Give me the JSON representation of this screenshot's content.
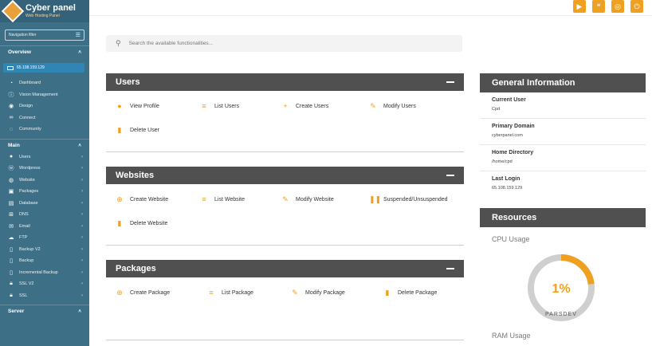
{
  "brand": {
    "title": "Cyber panel",
    "subtitle": "Web Hosting Panel"
  },
  "sidebar": {
    "filter_label": "Navigation filter",
    "overview_title": "Overview",
    "ip": "65.108.159.129",
    "overview_items": [
      {
        "label": "Dashboard",
        "icon": "gauge-icon"
      },
      {
        "label": "Vision Management",
        "icon": "info-icon"
      },
      {
        "label": "Design",
        "icon": "palette-icon"
      },
      {
        "label": "Connect",
        "icon": "link-icon"
      },
      {
        "label": "Community",
        "icon": "chat-icon"
      }
    ],
    "main_title": "Main",
    "main_items": [
      {
        "label": "Users",
        "icon": "users-icon"
      },
      {
        "label": "Wordpress",
        "icon": "wordpress-icon"
      },
      {
        "label": "Website",
        "icon": "globe-icon"
      },
      {
        "label": "Packages",
        "icon": "packages-icon"
      },
      {
        "label": "Database",
        "icon": "database-icon"
      },
      {
        "label": "DNS",
        "icon": "sitemap-icon"
      },
      {
        "label": "Email",
        "icon": "envelope-icon"
      },
      {
        "label": "FTP",
        "icon": "cloud-upload-icon"
      },
      {
        "label": "Backup V2",
        "icon": "file-icon"
      },
      {
        "label": "Backup",
        "icon": "file-icon"
      },
      {
        "label": "Incremental Backup",
        "icon": "file-icon"
      },
      {
        "label": "SSL V2",
        "icon": "lock-icon"
      },
      {
        "label": "SSL",
        "icon": "lock-icon"
      }
    ],
    "server_title": "Server"
  },
  "search": {
    "placeholder": "Search the available functionalities..."
  },
  "panels": {
    "users": {
      "title": "Users",
      "actions": [
        "View Profile",
        "List Users",
        "Create Users",
        "Modify Users",
        "Delete User"
      ]
    },
    "websites": {
      "title": "Websites",
      "actions": [
        "Create Website",
        "List Website",
        "Modify Website",
        "Suspended/Unsuspended",
        "Delete Website"
      ]
    },
    "packages": {
      "title": "Packages",
      "actions": [
        "Create Package",
        "List Package",
        "Modify Package",
        "Delete Package"
      ]
    }
  },
  "general_info": {
    "title": "General Information",
    "rows": [
      {
        "label": "Current User",
        "value": "Cpd"
      },
      {
        "label": "Primary Domain",
        "value": "cyberpanel.com"
      },
      {
        "label": "Home Directory",
        "value": "/home/cpd"
      },
      {
        "label": "Last Login",
        "value": "65.108.159.129"
      }
    ]
  },
  "resources": {
    "title": "Resources",
    "cpu_label": "CPU Usage",
    "cpu_percent": 1,
    "cpu_display": "1%",
    "ram_label": "RAM Usage",
    "watermark": "PARSDEV"
  },
  "colors": {
    "sidebar": "#3d6f86",
    "accent": "#f0a021",
    "panel_header": "#505050"
  }
}
